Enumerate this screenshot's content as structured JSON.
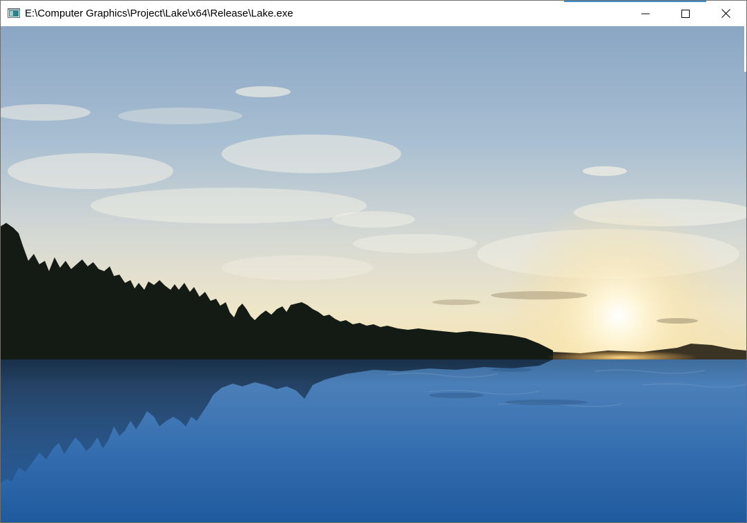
{
  "window": {
    "title": "E:\\Computer Graphics\\Project\\Lake\\x64\\Release\\Lake.exe",
    "app_icon": "console-app-icon",
    "controls": {
      "minimize_icon": "minimize-icon",
      "maximize_icon": "maximize-icon",
      "close_icon": "close-icon"
    }
  },
  "scene": {
    "content": "lake-at-sunset-render",
    "colors": {
      "sky_top": "#8aa6c4",
      "sky_horizon": "#e9e2c6",
      "sun": "#fff6d8",
      "tree_silhouette": "#141a14",
      "water_near": "#1f5a9e",
      "water_far": "#4b7fb8"
    }
  }
}
